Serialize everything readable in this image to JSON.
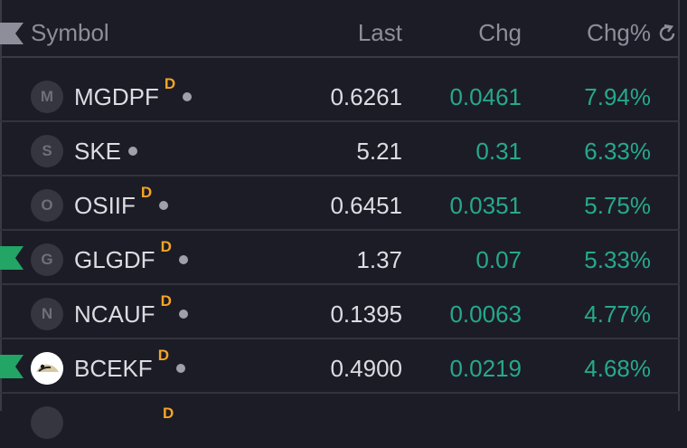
{
  "header": {
    "symbol": "Symbol",
    "last": "Last",
    "chg": "Chg",
    "chg_pct": "Chg%"
  },
  "colors": {
    "positive": "#26a98a",
    "d_badge": "#f5a524",
    "flag_green": "#22a565",
    "flag_grey": "#8e8e9a"
  },
  "rows": [
    {
      "logo": "M",
      "symbol": "MGDPF",
      "badge": "D",
      "last": "0.6261",
      "chg": "0.0461",
      "chg_pct": "7.94%",
      "flagged": false
    },
    {
      "logo": "S",
      "symbol": "SKE",
      "badge": "",
      "last": "5.21",
      "chg": "0.31",
      "chg_pct": "6.33%",
      "flagged": false
    },
    {
      "logo": "O",
      "symbol": "OSIIF",
      "badge": "D",
      "last": "0.6451",
      "chg": "0.0351",
      "chg_pct": "5.75%",
      "flagged": false
    },
    {
      "logo": "G",
      "symbol": "GLGDF",
      "badge": "D",
      "last": "1.37",
      "chg": "0.07",
      "chg_pct": "5.33%",
      "flagged": true
    },
    {
      "logo": "N",
      "symbol": "NCAUF",
      "badge": "D",
      "last": "0.1395",
      "chg": "0.0063",
      "chg_pct": "4.77%",
      "flagged": false
    },
    {
      "logo": "",
      "symbol": "BCEKF",
      "badge": "D",
      "last": "0.4900",
      "chg": "0.0219",
      "chg_pct": "4.68%",
      "flagged": true
    }
  ],
  "partial_row": {
    "badge": "D"
  }
}
